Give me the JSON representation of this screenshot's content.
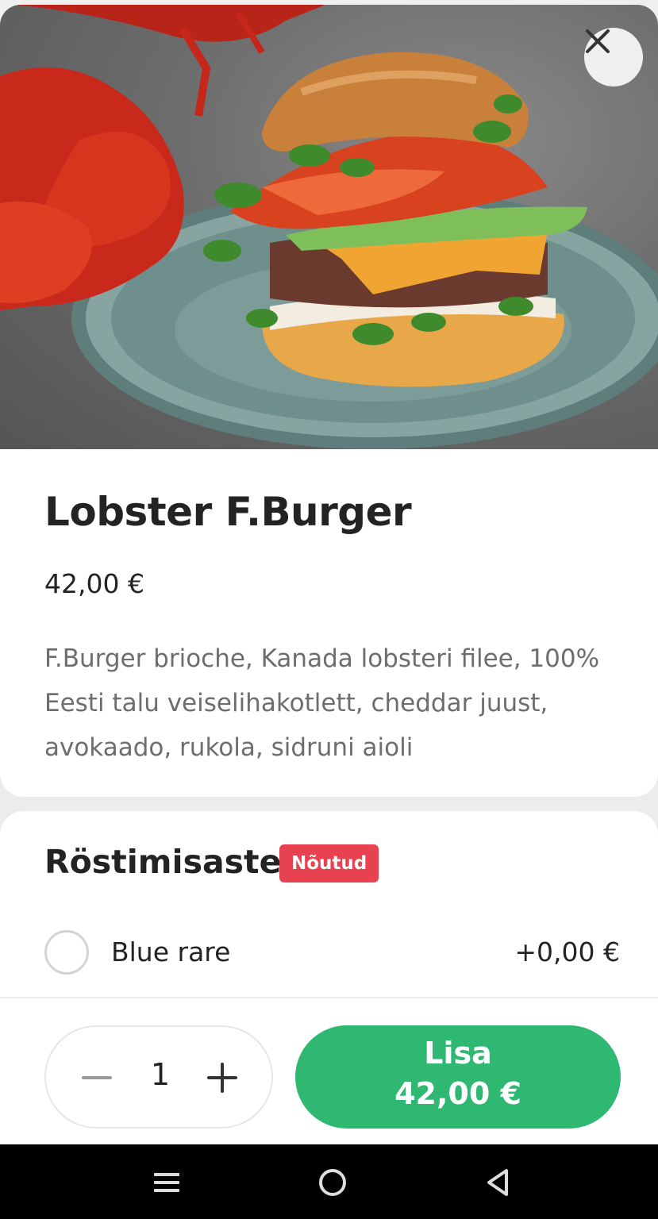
{
  "product": {
    "image_alt": "Lobster burger on a speckled plate with a whole lobster",
    "title": "Lobster F.Burger",
    "price": "42,00 €",
    "description": "F.Burger brioche, Kanada lobsteri filee, 100% Eesti talu veiselihakotlett, cheddar juust, avokaado, rukola, sidruni aioli"
  },
  "options": {
    "group_title": "Röstimisaste",
    "required_badge": "Nõutud",
    "items": [
      {
        "label": "Blue rare",
        "price": "+0,00 €",
        "selected": false
      }
    ]
  },
  "cart": {
    "quantity": "1",
    "add_label": "Lisa",
    "add_price": "42,00 €"
  },
  "colors": {
    "accent_green": "#2eb872",
    "badge_red": "#e8414f"
  },
  "icons": [
    "close-icon",
    "minus-icon",
    "plus-icon",
    "menu-icon",
    "home-icon",
    "back-icon"
  ]
}
